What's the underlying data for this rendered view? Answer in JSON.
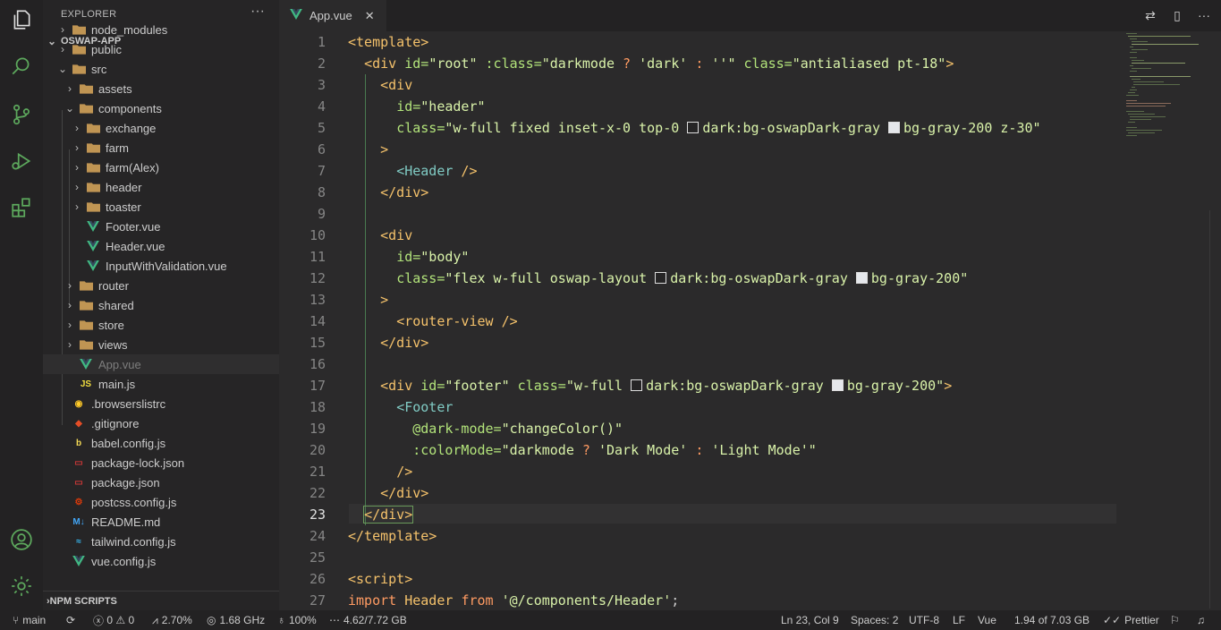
{
  "explorer": {
    "title": "EXPLORER",
    "more": "···",
    "project": "OSWAP-APP",
    "items": [
      {
        "label": "node_modules",
        "type": "folder",
        "depth": 0,
        "open": false
      },
      {
        "label": "public",
        "type": "folder",
        "depth": 0,
        "open": false
      },
      {
        "label": "src",
        "type": "folder",
        "depth": 0,
        "open": true
      },
      {
        "label": "assets",
        "type": "folder",
        "depth": 1,
        "open": false
      },
      {
        "label": "components",
        "type": "folder",
        "depth": 1,
        "open": true
      },
      {
        "label": "exchange",
        "type": "folder",
        "depth": 2,
        "open": false
      },
      {
        "label": "farm",
        "type": "folder",
        "depth": 2,
        "open": false
      },
      {
        "label": "farm(Alex)",
        "type": "folder",
        "depth": 2,
        "open": false
      },
      {
        "label": "header",
        "type": "folder",
        "depth": 2,
        "open": false
      },
      {
        "label": "toaster",
        "type": "folder",
        "depth": 2,
        "open": false
      },
      {
        "label": "Footer.vue",
        "type": "vue",
        "depth": 2
      },
      {
        "label": "Header.vue",
        "type": "vue",
        "depth": 2
      },
      {
        "label": "InputWithValidation.vue",
        "type": "vue",
        "depth": 2
      },
      {
        "label": "router",
        "type": "folder",
        "depth": 1,
        "open": false
      },
      {
        "label": "shared",
        "type": "folder",
        "depth": 1,
        "open": false
      },
      {
        "label": "store",
        "type": "folder",
        "depth": 1,
        "open": false
      },
      {
        "label": "views",
        "type": "folder",
        "depth": 1,
        "open": false
      },
      {
        "label": "App.vue",
        "type": "vue",
        "depth": 1,
        "active": true
      },
      {
        "label": "main.js",
        "type": "js",
        "depth": 1
      },
      {
        "label": ".browserslistrc",
        "type": "cfg",
        "depth": 0
      },
      {
        "label": ".gitignore",
        "type": "git",
        "depth": 0
      },
      {
        "label": "babel.config.js",
        "type": "babel",
        "depth": 0
      },
      {
        "label": "package-lock.json",
        "type": "npm",
        "depth": 0
      },
      {
        "label": "package.json",
        "type": "npm",
        "depth": 0
      },
      {
        "label": "postcss.config.js",
        "type": "postcss",
        "depth": 0
      },
      {
        "label": "README.md",
        "type": "md",
        "depth": 0
      },
      {
        "label": "tailwind.config.js",
        "type": "tailwind",
        "depth": 0
      },
      {
        "label": "vue.config.js",
        "type": "vue",
        "depth": 0
      }
    ],
    "npm_scripts": "NPM SCRIPTS"
  },
  "tab": {
    "label": "App.vue",
    "close": "✕"
  },
  "editor": {
    "current_line": 23,
    "line_numbers": [
      "1",
      "2",
      "3",
      "4",
      "5",
      "6",
      "7",
      "8",
      "9",
      "10",
      "11",
      "12",
      "13",
      "14",
      "15",
      "16",
      "17",
      "18",
      "19",
      "20",
      "21",
      "22",
      "23",
      "24",
      "25",
      "26",
      "27"
    ],
    "code": {
      "l1_tag": "<template>",
      "l2_div": "<div",
      "l2_id_attr": " id=",
      "l2_id_val": "\"root\"",
      "l2_class_attr": " :class=",
      "l2_class_val1": "\"darkmode",
      "l2_q": " ? ",
      "l2_class_val2": "'dark'",
      "l2_colon": " : ",
      "l2_class_val3": "''\"",
      "l2_class2_attr": " class=",
      "l2_class2_val": "\"antialiased pt-18\"",
      "l2_end": ">",
      "l3": "<div",
      "l4_attr": "id=",
      "l4_val": "\"header\"",
      "l5_attr": "class=",
      "l5_val1": "\"w-full fixed inset-x-0 top-0 ",
      "l5_val2": "dark:bg-oswapDark-gray ",
      "l5_val3": "bg-gray-200 z-30\"",
      "l6": ">",
      "l7_tag": "<Header",
      "l7_end": " />",
      "l8": "</div>",
      "l10": "<div",
      "l11_attr": "id=",
      "l11_val": "\"body\"",
      "l12_attr": "class=",
      "l12_val1": "\"flex w-full oswap-layout ",
      "l12_val2": "dark:bg-oswapDark-gray ",
      "l12_val3": "bg-gray-200\"",
      "l13": ">",
      "l14_tag": "<router-view",
      "l14_end": " />",
      "l15": "</div>",
      "l17_div": "<div",
      "l17_id_attr": " id=",
      "l17_id_val": "\"footer\"",
      "l17_class_attr": " class=",
      "l17_val1": "\"w-full ",
      "l17_val2": "dark:bg-oswapDark-gray ",
      "l17_val3": "bg-gray-200\"",
      "l17_end": ">",
      "l18": "<Footer",
      "l19_attr": "@dark-mode=",
      "l19_val": "\"changeColor()\"",
      "l20_attr": ":colorMode=",
      "l20_val1": "\"darkmode",
      "l20_q": " ? ",
      "l20_val2": "'Dark Mode'",
      "l20_colon": " : ",
      "l20_val3": "'Light Mode'\"",
      "l21": "/>",
      "l22": "</div>",
      "l23": "</div>",
      "l24": "</template>",
      "l26": "<script>",
      "l27_kw": "import",
      "l27_name": " Header ",
      "l27_from": "from",
      "l27_path": " '@/components/Header'",
      "l27_end": ";"
    }
  },
  "statusbar": {
    "branch": "main",
    "sync": "⟳",
    "errors": "0",
    "warnings": "0",
    "cpu": "2.70%",
    "freq": "1.68 GHz",
    "battery": "100%",
    "memory": "4.62/7.72 GB",
    "position": "Ln 23, Col 9",
    "spaces": "Spaces: 2",
    "encoding": "UTF-8",
    "eol": "LF",
    "language": "Vue",
    "mem2": "1.94 of 7.03 GB",
    "prettier": "Prettier"
  },
  "colors": {
    "accent": "#8bc34a",
    "background": "#2b2a2b",
    "vue": "#41b883"
  }
}
